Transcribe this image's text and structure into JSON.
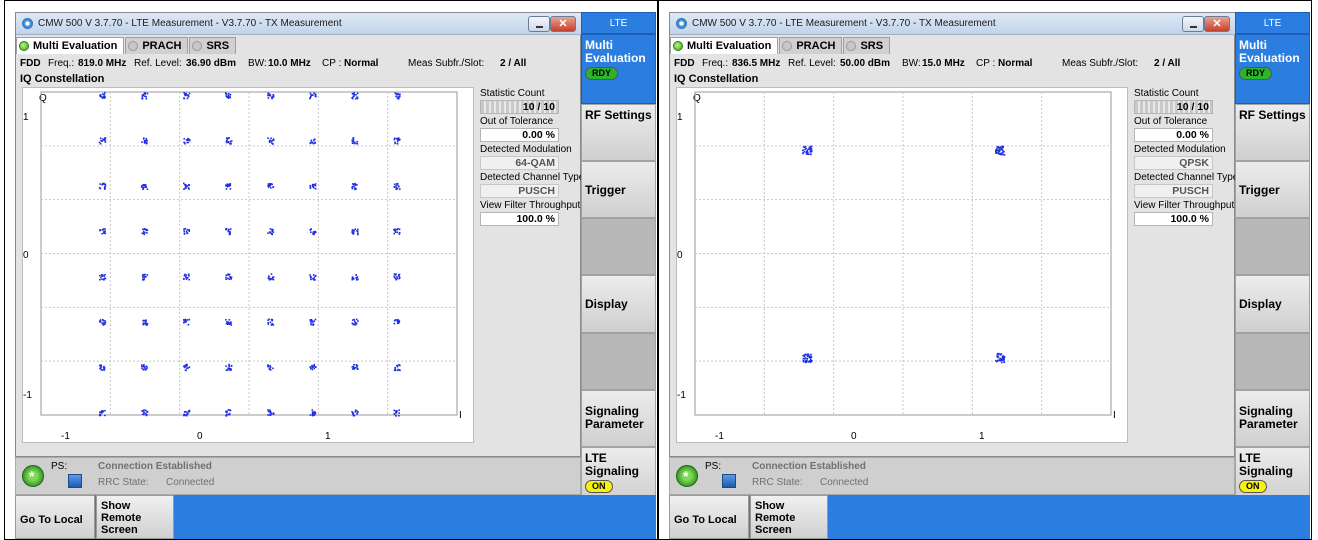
{
  "panels": [
    {
      "title": "CMW 500 V 3.7.70 - LTE Measurement  - V3.7.70 - TX Measurement",
      "tabs": [
        "Multi Evaluation",
        "PRACH",
        "SRS"
      ],
      "info": {
        "duplex": "FDD",
        "freq_label": "Freq.:",
        "freq": "819.0 MHz",
        "ref_label": "Ref. Level:",
        "ref": "36.90 dBm",
        "bw_label": "BW:",
        "bw": "10.0 MHz",
        "cp_label": "CP :",
        "cp": "Normal",
        "meas_label": "Meas Subfr./Slot:",
        "meas": "2  / All"
      },
      "section": "IQ Constellation",
      "axes": {
        "q": "Q",
        "i": "I",
        "y_ticks": [
          "1",
          "0",
          "-1"
        ],
        "x_ticks": [
          "-1",
          "0",
          "1"
        ]
      },
      "stats": {
        "count_label": "Statistic Count",
        "count": "10 / 10",
        "tol_label": "Out of Tolerance",
        "tol": "0.00  %",
        "mod_label": "Detected Modulation",
        "mod": "64-QAM",
        "chan_label": "Detected Channel Type",
        "chan": "PUSCH",
        "thr_label": "View Filter Throughput",
        "thr": "100.0  %"
      },
      "status": {
        "ps": "PS:",
        "conn": "Connection Established",
        "rrc_label": "RRC State:",
        "rrc": "Connected"
      },
      "side": {
        "header": "LTE",
        "multi": "Multi Evaluation",
        "rdy": "RDY",
        "rf": "RF Settings",
        "trigger": "Trigger",
        "display": "Display",
        "signaling": "Signaling Parameter",
        "lte_sig": "LTE Signaling",
        "on": "ON"
      },
      "bottom": {
        "local": "Go To Local",
        "remote": "Show Remote Screen"
      },
      "constellation": {
        "modulation": "64-QAM",
        "grid": 8
      }
    },
    {
      "title": "CMW 500 V 3.7.70 - LTE Measurement  - V3.7.70 - TX Measurement",
      "tabs": [
        "Multi Evaluation",
        "PRACH",
        "SRS"
      ],
      "info": {
        "duplex": "FDD",
        "freq_label": "Freq.:",
        "freq": "836.5 MHz",
        "ref_label": "Ref. Level:",
        "ref": "50.00 dBm",
        "bw_label": "BW:",
        "bw": "15.0 MHz",
        "cp_label": "CP :",
        "cp": "Normal",
        "meas_label": "Meas Subfr./Slot:",
        "meas": "2  / All"
      },
      "section": "IQ Constellation",
      "axes": {
        "q": "Q",
        "i": "I",
        "y_ticks": [
          "1",
          "0",
          "-1"
        ],
        "x_ticks": [
          "-1",
          "0",
          "1"
        ]
      },
      "stats": {
        "count_label": "Statistic Count",
        "count": "10 / 10",
        "tol_label": "Out of Tolerance",
        "tol": "0.00  %",
        "mod_label": "Detected Modulation",
        "mod": "QPSK",
        "chan_label": "Detected Channel Type",
        "chan": "PUSCH",
        "thr_label": "View Filter Throughput",
        "thr": "100.0  %"
      },
      "status": {
        "ps": "PS:",
        "conn": "Connection Established",
        "rrc_label": "RRC State:",
        "rrc": "Connected"
      },
      "side": {
        "header": "LTE",
        "multi": "Multi Evaluation",
        "rdy": "RDY",
        "rf": "RF Settings",
        "trigger": "Trigger",
        "display": "Display",
        "signaling": "Signaling Parameter",
        "lte_sig": "LTE Signaling",
        "on": "ON"
      },
      "bottom": {
        "local": "Go To Local",
        "remote": "Show Remote Screen"
      },
      "constellation": {
        "modulation": "QPSK",
        "grid": 2
      }
    }
  ],
  "colors": {
    "accent": "#2b7de0",
    "points": "#1f2fe0",
    "rdy": "#2bb52b",
    "on": "#f6f20c"
  }
}
